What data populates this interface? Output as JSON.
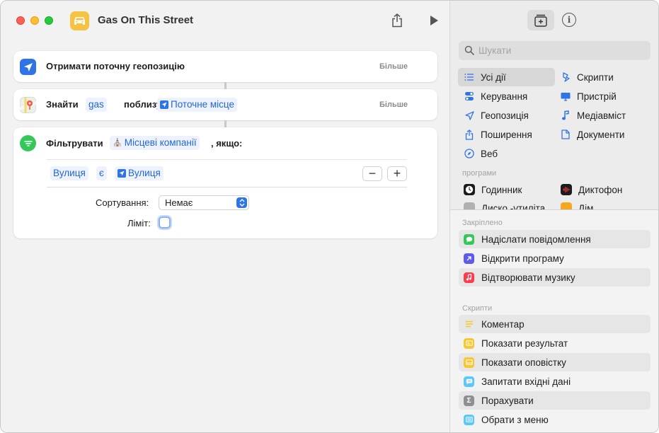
{
  "window": {
    "title": "Gas On This Street"
  },
  "editor": {
    "actions": [
      {
        "label": "Отримати поточну геопозицію",
        "more": "Більше"
      },
      {
        "label": "Знайти",
        "query": "gas",
        "near": "поблизу",
        "location": "Поточне місце",
        "more": "Більше"
      },
      {
        "label": "Фільтрувати",
        "source": "Місцеві компанії",
        "suffix": ", якщо:",
        "condition": {
          "field": "Вулиця",
          "operator": "є",
          "value": "Вулиця"
        },
        "sort_label": "Сортування:",
        "sort_value": "Немає",
        "limit_label": "Ліміт:",
        "limit_on": false
      }
    ]
  },
  "sidebar": {
    "search_placeholder": "Шукати",
    "categories": [
      {
        "label": "Усі дії",
        "icon": "list-icon",
        "selected": true
      },
      {
        "label": "Скрипти",
        "icon": "script-icon"
      },
      {
        "label": "Керування",
        "icon": "toggle-icon"
      },
      {
        "label": "Пристрій",
        "icon": "monitor-icon"
      },
      {
        "label": "Геопозиція",
        "icon": "location-arrow-icon"
      },
      {
        "label": "Медіавміст",
        "icon": "music-note-icon"
      },
      {
        "label": "Поширення",
        "icon": "share-icon"
      },
      {
        "label": "Документи",
        "icon": "document-icon"
      },
      {
        "label": "Веб",
        "icon": "compass-icon"
      }
    ],
    "apps_header": "програми",
    "apps": [
      {
        "label": "Годинник",
        "icon": "clock-icon",
        "color": "#1c1c1e"
      },
      {
        "label": "Диктофон",
        "icon": "voice-memos-icon",
        "color": "#1c1c1e"
      },
      {
        "label": "Диско.-утиліта",
        "icon": "disk-utility-icon",
        "color": "#b0b0b0"
      },
      {
        "label": "Дім",
        "icon": "home-icon",
        "color": "#f5a623"
      }
    ],
    "pinned_header": "Закріплено",
    "pinned": [
      {
        "label": "Надіслати повідомлення",
        "icon": "messages-icon",
        "color": "#34c759"
      },
      {
        "label": "Відкрити програму",
        "icon": "open-app-icon",
        "color": "#5e5ce6"
      },
      {
        "label": "Відтворювати музику",
        "icon": "music-icon",
        "color": "#fa3c4c"
      }
    ],
    "scripts_header": "Скрипти",
    "scripts": [
      {
        "label": "Коментар",
        "icon": "comment-icon",
        "color": "#f7d547"
      },
      {
        "label": "Показати результат",
        "icon": "show-result-icon",
        "color": "#f7c72f"
      },
      {
        "label": "Показати оповістку",
        "icon": "alert-icon",
        "color": "#f7c72f"
      },
      {
        "label": "Запитати вхідні дані",
        "icon": "ask-input-icon",
        "color": "#5ac8fa"
      },
      {
        "label": "Порахувати",
        "icon": "sigma-icon",
        "color": "#8e8e93"
      },
      {
        "label": "Обрати з меню",
        "icon": "menu-icon",
        "color": "#5ac8fa"
      }
    ]
  }
}
